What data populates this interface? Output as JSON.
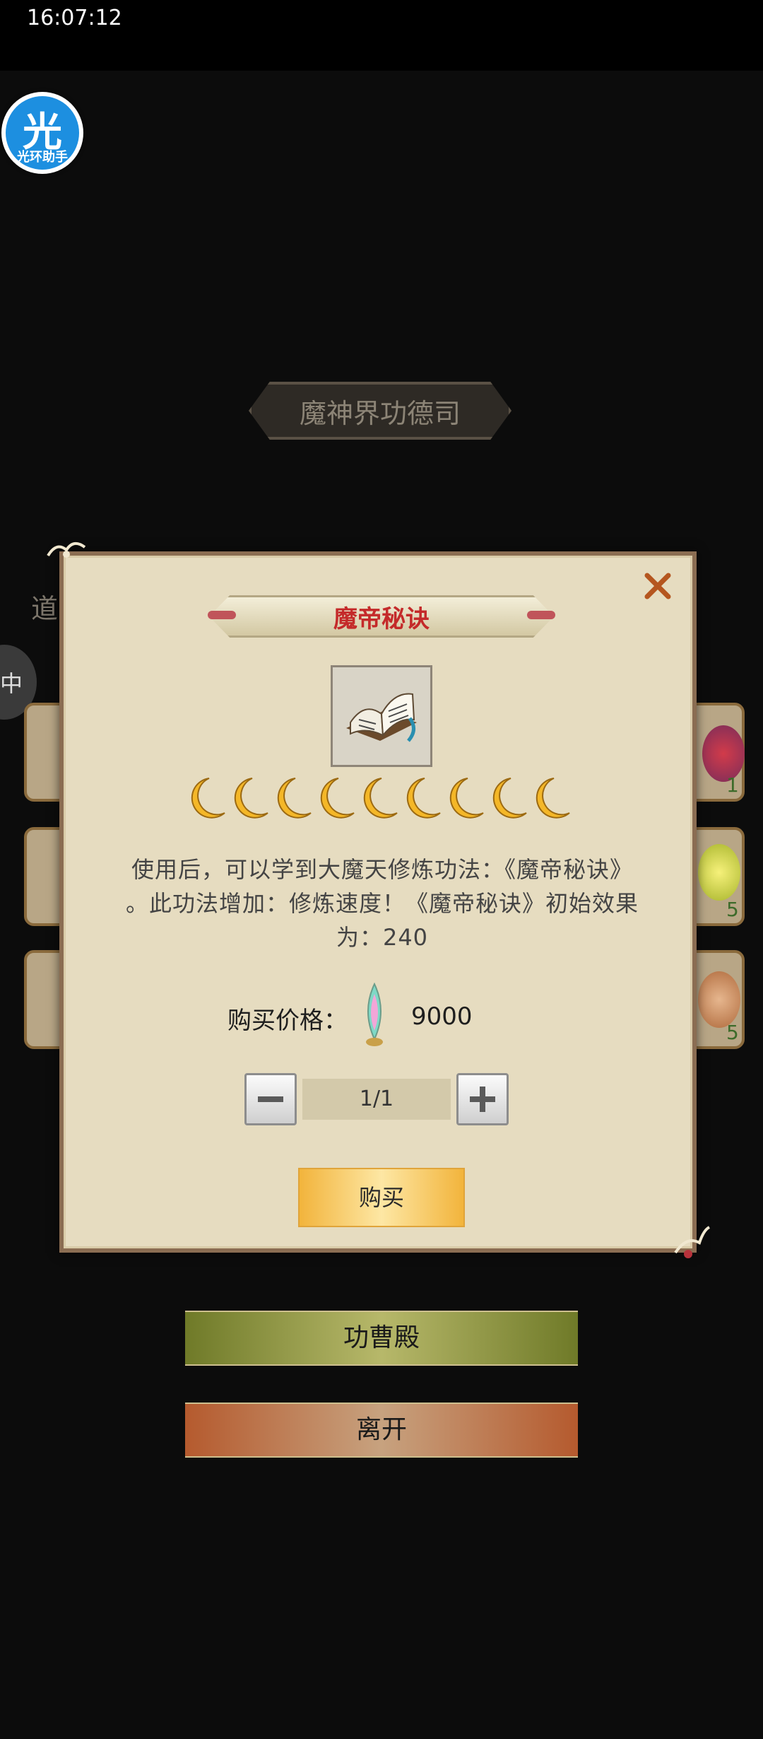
{
  "status_bar": {
    "time": "16:07:12"
  },
  "helper": {
    "glyph": "光",
    "label": "光环助手"
  },
  "background": {
    "title": "魔神界功德司",
    "side_text": "道",
    "side_circle_text": "中",
    "slots": [
      {
        "count": "1"
      },
      {
        "count": "5"
      },
      {
        "count": "5"
      }
    ],
    "hall_button": "功曹殿",
    "leave_button": "离开"
  },
  "modal": {
    "title": "魔帝秘诀",
    "star_count": 9,
    "description_lines": [
      "使用后，可以学到大魔天修炼功法：《魔帝秘诀》",
      "。此功法增加：修炼速度！《魔帝秘诀》初始效果",
      "为：240"
    ],
    "price_label": "购买价格：",
    "price_value": "9000",
    "quantity": "1/1",
    "buy_label": "购买"
  },
  "icons": {
    "close": "close-icon",
    "book": "book-icon",
    "moon": "moon-icon",
    "gem": "gem-icon",
    "minus": "minus-icon",
    "plus": "plus-icon"
  },
  "colors": {
    "modal_bg": "#e6dcc0",
    "title_red": "#c42a2a",
    "buy_gold": "#f2b43c"
  }
}
